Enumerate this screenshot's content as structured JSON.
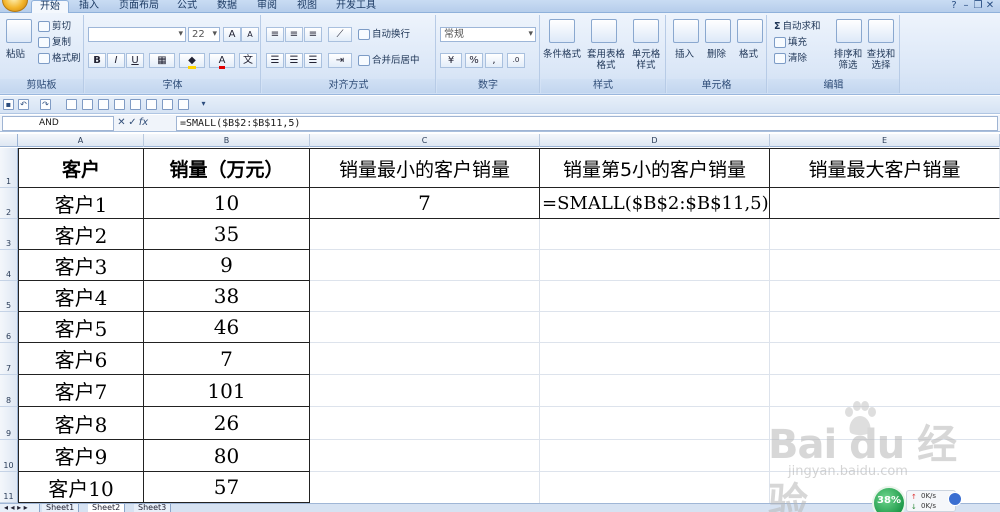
{
  "ribbon": {
    "tabs": [
      "开始",
      "插入",
      "页面布局",
      "公式",
      "数据",
      "审阅",
      "视图",
      "开发工具"
    ],
    "active_tab": "开始",
    "clipboard": {
      "paste": "粘贴",
      "cut": "剪切",
      "copy": "复制",
      "format_painter": "格式刷",
      "label": "剪贴板"
    },
    "font": {
      "font_name": "",
      "font_size": "22",
      "bold": "B",
      "italic": "I",
      "underline": "U",
      "label": "字体",
      "grow": "A",
      "shrink": "A"
    },
    "alignment": {
      "wrap": "自动换行",
      "merge": "合并后居中",
      "label": "对齐方式"
    },
    "number": {
      "format": "常规",
      "percent": "%",
      "comma": ",",
      "label": "数字"
    },
    "styles": {
      "conditional": "条件格式",
      "table": "套用表格格式",
      "cell": "单元格样式",
      "label": "样式"
    },
    "cells": {
      "insert": "插入",
      "delete": "删除",
      "format": "格式",
      "label": "单元格"
    },
    "editing": {
      "autosum": "自动求和",
      "fill": "填充",
      "clear": "清除",
      "sort": "排序和筛选",
      "find": "查找和选择",
      "label": "编辑"
    }
  },
  "formula_bar": {
    "name_box": "AND",
    "cancel": "✕",
    "enter": "✓",
    "fx": "fx",
    "content": "=SMALL($B$2:$B$11,5)"
  },
  "columns": [
    "A",
    "B",
    "C",
    "D",
    "E"
  ],
  "rows": [
    "1",
    "2",
    "3",
    "4",
    "5",
    "6",
    "7",
    "8",
    "9",
    "10",
    "11"
  ],
  "table": {
    "header_customer": "客户",
    "header_sales": "销量（万元）",
    "customers": [
      "客户1",
      "客户2",
      "客户3",
      "客户4",
      "客户5",
      "客户6",
      "客户7",
      "客户8",
      "客户9",
      "客户10"
    ],
    "sales": [
      "10",
      "35",
      "9",
      "38",
      "46",
      "7",
      "101",
      "26",
      "80",
      "57"
    ]
  },
  "result_headers": {
    "c1": "销量最小的客户销量",
    "d1": "销量第5小的客户销量",
    "e1": "销量最大客户销量"
  },
  "result_values": {
    "c2": "7",
    "d2": "=SMALL($B$2:$B$11,5)",
    "e2": ""
  },
  "sheet_tabs": [
    "Sheet1",
    "Sheet2",
    "Sheet3"
  ],
  "watermark": {
    "logo": "Bai du 经验",
    "url": "jingyan.baidu.com"
  },
  "network_widget": {
    "percent": "38%",
    "up": "0K/s",
    "down": "0K/s"
  }
}
